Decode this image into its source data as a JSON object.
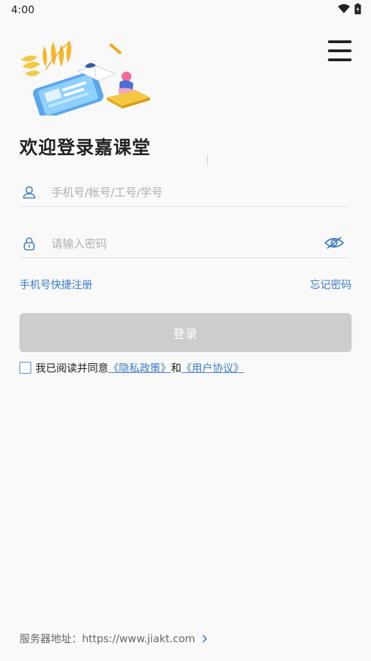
{
  "status_bar": {
    "time": "4:00"
  },
  "welcome_title": "欢迎登录嘉课堂",
  "account_field": {
    "placeholder": "手机号/帐号/工号/学号",
    "value": ""
  },
  "password_field": {
    "placeholder": "请输入密码",
    "value": ""
  },
  "links": {
    "quick_register": "手机号快捷注册",
    "forgot_password": "忘记密码"
  },
  "login_button": "登录",
  "agreement": {
    "prefix": "我已阅读并同意",
    "privacy_policy": "《隐私政策》",
    "conjunction": "和",
    "user_agreement": "《用户协议》",
    "checked": false
  },
  "server": {
    "label": "服务器地址：",
    "url": "https://www.jiakt.com"
  },
  "colors": {
    "link": "#3d7cc9",
    "button_disabled": "#cdcdcd",
    "background": "#f9f9f9"
  },
  "icons": [
    "wifi-icon",
    "battery-icon",
    "menu-icon",
    "user-icon",
    "lock-icon",
    "eye-hidden-icon",
    "chevron-right-icon"
  ]
}
